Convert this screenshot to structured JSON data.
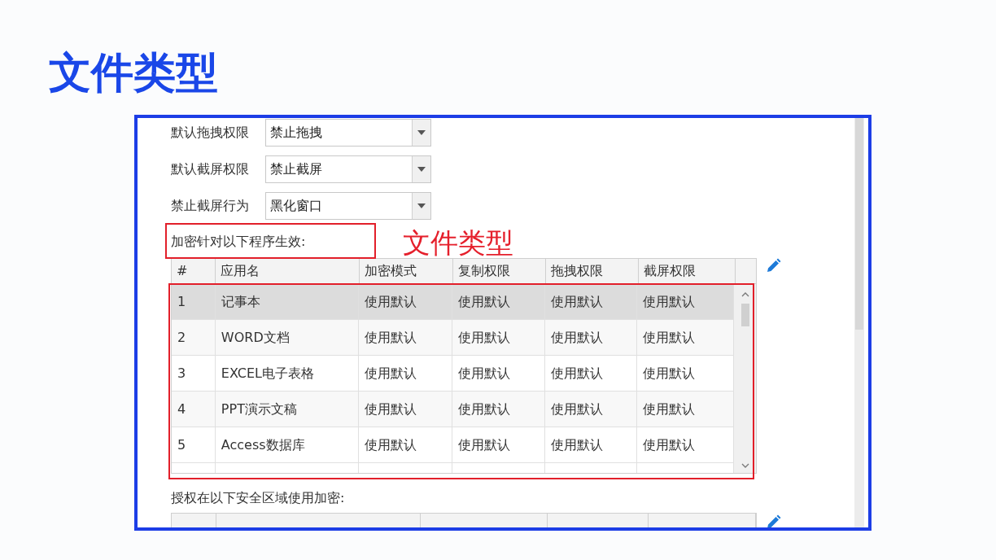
{
  "title": "文件类型",
  "settings": [
    {
      "label": "默认拖拽权限",
      "value": "禁止拖拽"
    },
    {
      "label": "默认截屏权限",
      "value": "禁止截屏"
    },
    {
      "label": "禁止截屏行为",
      "value": "黑化窗口"
    }
  ],
  "apps_section": {
    "label": "加密针对以下程序生效:",
    "annotation": "文件类型",
    "columns": [
      "#",
      "应用名",
      "加密模式",
      "复制权限",
      "拖拽权限",
      "截屏权限"
    ],
    "rows": [
      {
        "cells": [
          "1",
          "记事本",
          "使用默认",
          "使用默认",
          "使用默认",
          "使用默认"
        ],
        "selected": true
      },
      {
        "cells": [
          "2",
          "WORD文档",
          "使用默认",
          "使用默认",
          "使用默认",
          "使用默认"
        ],
        "selected": false
      },
      {
        "cells": [
          "3",
          "EXCEL电子表格",
          "使用默认",
          "使用默认",
          "使用默认",
          "使用默认"
        ],
        "selected": false
      },
      {
        "cells": [
          "4",
          "PPT演示文稿",
          "使用默认",
          "使用默认",
          "使用默认",
          "使用默认"
        ],
        "selected": false
      },
      {
        "cells": [
          "5",
          "Access数据库",
          "使用默认",
          "使用默认",
          "使用默认",
          "使用默认"
        ],
        "selected": false
      }
    ]
  },
  "zones_section": {
    "label": "授权在以下安全区域使用加密:"
  }
}
